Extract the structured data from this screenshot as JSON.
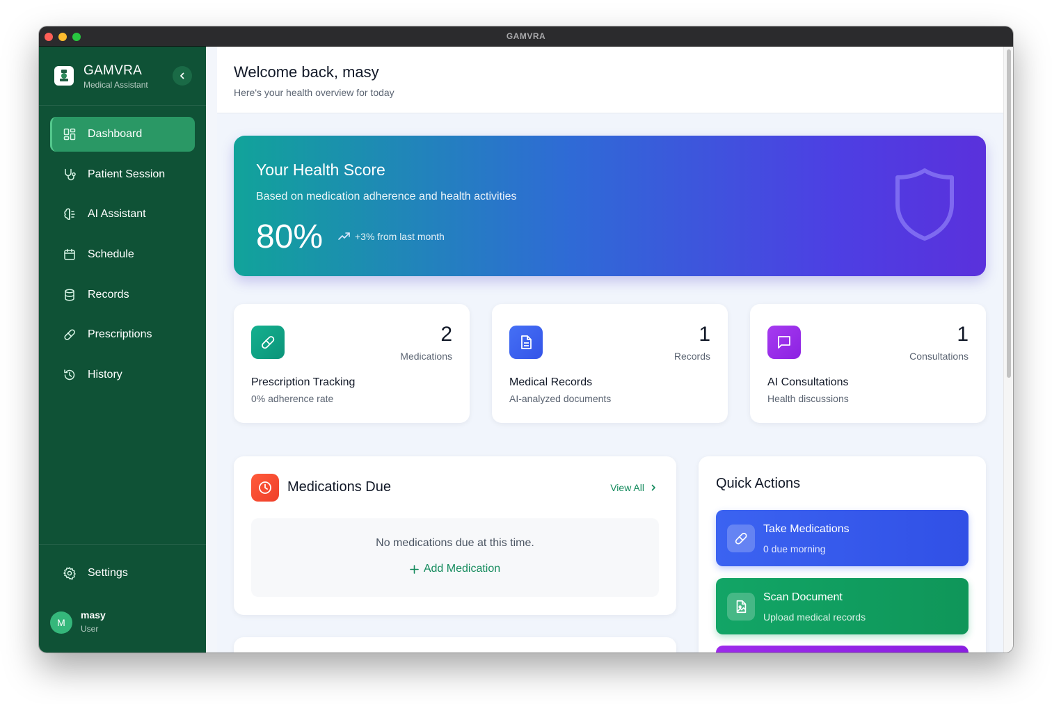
{
  "window": {
    "title": "GAMVRA"
  },
  "brand": {
    "name": "GAMVRA",
    "subtitle": "Medical Assistant"
  },
  "sidebar": {
    "items": [
      {
        "label": "Dashboard",
        "icon": "dashboard-icon",
        "active": true
      },
      {
        "label": "Patient Session",
        "icon": "stethoscope-icon"
      },
      {
        "label": "AI Assistant",
        "icon": "brain-icon"
      },
      {
        "label": "Schedule",
        "icon": "calendar-icon"
      },
      {
        "label": "Records",
        "icon": "database-icon"
      },
      {
        "label": "Prescriptions",
        "icon": "pill-icon"
      },
      {
        "label": "History",
        "icon": "history-icon"
      }
    ],
    "settings_label": "Settings",
    "user": {
      "initial": "M",
      "name": "masy",
      "role": "User"
    }
  },
  "header": {
    "title": "Welcome back, masy",
    "subtitle": "Here's your health overview for today"
  },
  "health_score": {
    "title": "Your Health Score",
    "subtitle": "Based on medication adherence and health activities",
    "score": "80%",
    "trend": "+3% from last month"
  },
  "stats": [
    {
      "count": "2",
      "unit": "Medications",
      "title": "Prescription Tracking",
      "subtitle": "0% adherence rate",
      "color": "#0f9f86"
    },
    {
      "count": "1",
      "unit": "Records",
      "title": "Medical Records",
      "subtitle": "AI-analyzed documents",
      "color": "#3a5ff0"
    },
    {
      "count": "1",
      "unit": "Consultations",
      "title": "AI Consultations",
      "subtitle": "Health discussions",
      "color": "#9b2eea"
    }
  ],
  "medications_due": {
    "title": "Medications Due",
    "view_all": "View All",
    "empty_text": "No medications due at this time.",
    "add_label": "Add Medication"
  },
  "quick_actions": {
    "title": "Quick Actions",
    "buttons": [
      {
        "label": "Take Medications",
        "subtitle": "0 due morning",
        "icon": "pill-icon"
      },
      {
        "label": "Scan Document",
        "subtitle": "Upload medical records",
        "icon": "file-scan-icon"
      },
      {
        "label": "",
        "subtitle": "",
        "icon": ""
      }
    ]
  },
  "colors": {
    "sidebar": "#0f5236",
    "accent": "#138a5c",
    "active_nav": "#2a9865"
  }
}
